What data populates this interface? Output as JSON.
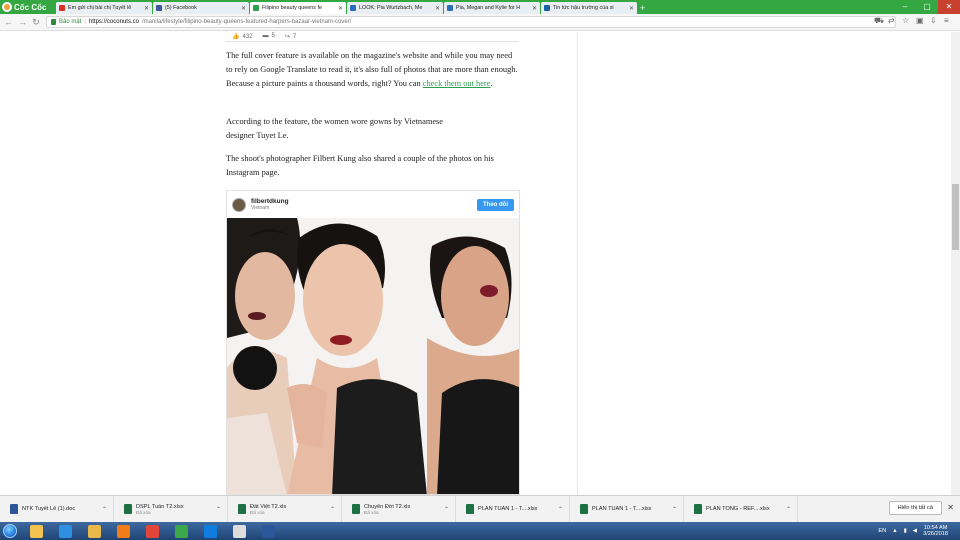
{
  "browser": {
    "brand": "Cốc Cốc",
    "tabs": [
      {
        "title": "Em gửi chị bài chị Tuyết lê",
        "favicon_color": "#d93025",
        "favicon": "gmail-icon"
      },
      {
        "title": "(5) Facebook",
        "favicon_color": "#3b5998",
        "favicon": "facebook-icon"
      },
      {
        "title": "Filipino beauty queens fe",
        "favicon_color": "#2e9e4b",
        "favicon": "coconuts-icon",
        "active": true
      },
      {
        "title": "LOOK: Pia Wurtzbach, Me",
        "favicon_color": "#2a6ebb",
        "favicon": "site-icon"
      },
      {
        "title": "Pia, Megan and Kylie for H",
        "favicon_color": "#2a6ebb",
        "favicon": "site-icon"
      },
      {
        "title": "Tin tức hậu trường của si",
        "favicon_color": "#1a5fa8",
        "favicon": "site-icon"
      }
    ],
    "secure_label": "Bảo mật",
    "url_host": "https://coconuts.co",
    "url_path": "/manila/lifestyle/filipino-beauty-queens-featured-harpers-bazaar-vietnam-cover/"
  },
  "article": {
    "reactions": {
      "likes": "432",
      "comments": "5",
      "shares": "7"
    },
    "p1_text": "The full cover feature is available on the magazine's website and while you may need to rely on Google Translate to read it, it's also full of photos that are more than enough. Because a picture paints a thousand words, right? You can ",
    "p1_link": "check them out here",
    "p1_end": ".",
    "p2_line1": "According to the feature, the women wore gowns by Vietnamese",
    "p2_line2": "designer Tuyet Le.",
    "p3": "The shoot's photographer Filbert Kung also shared a couple of the photos on his Instagram page."
  },
  "instagram": {
    "username": "filbertdkung",
    "location": "Vietnam",
    "follow_label": "Theo dõi"
  },
  "downloads": {
    "items": [
      {
        "name": "NTK Tuyết Lê (1).doc",
        "status": "",
        "color": "#2b579a"
      },
      {
        "name": "DSPL Tuần T2.xlsx",
        "status": "Đã xóa",
        "color": "#1e7145"
      },
      {
        "name": "Đất Việt T2.xls",
        "status": "Đã xóa",
        "color": "#1e7145"
      },
      {
        "name": "Chuyên Đời T2.xls",
        "status": "Đã xóa",
        "color": "#1e7145"
      },
      {
        "name": "PLAN TUẦN 1 - T....xlsx",
        "status": "",
        "color": "#1e7145"
      },
      {
        "name": "PLAN TUẦN 1 - T....xlsx",
        "status": "",
        "color": "#1e7145"
      },
      {
        "name": "PLAN TỔNG - REF....xlsx",
        "status": "",
        "color": "#1e7145"
      }
    ],
    "show_all_label": "Hiển thị tất cả"
  },
  "taskbar": {
    "apps": [
      {
        "name": "explorer-icon",
        "color": "#f2c14e"
      },
      {
        "name": "ie-icon",
        "color": "#2f8fe0"
      },
      {
        "name": "folder-icon",
        "color": "#e8b84a"
      },
      {
        "name": "media-player-icon",
        "color": "#f07d1a"
      },
      {
        "name": "chrome-icon",
        "color": "#e2463b"
      },
      {
        "name": "coccoc-icon",
        "color": "#3aa84b"
      },
      {
        "name": "zalo-icon",
        "color": "#0f7de0"
      },
      {
        "name": "app-icon",
        "color": "#dddddd"
      },
      {
        "name": "word-icon",
        "color": "#2b579a"
      }
    ],
    "language": "EN",
    "time": "10:54 AM",
    "date": "3/26/2018"
  }
}
